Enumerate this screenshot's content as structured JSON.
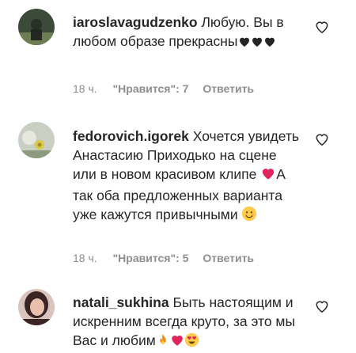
{
  "comments": [
    {
      "username": "iaroslavagudzenko",
      "text": "Любую. Вы в любом образе прекрасны",
      "time": "18 ч.",
      "likes": "\"Нравится\": 7",
      "reply": "Ответить",
      "avatar_icon": "profile-photo-dark"
    },
    {
      "username": "fedorovich.igorek",
      "text": "Хочется увидеть Анастасию Приходько на сцене или в новом красивом клипе",
      "text2": "А так оба предложенных варианта уже кажутся привычными",
      "time": "18 ч.",
      "likes": "\"Нравится\": 5",
      "reply": "Ответить",
      "avatar_icon": "profile-photo-flower"
    },
    {
      "username": "natali_sukhina",
      "text": "Быть настоящим и искренним всегда круто, за это мы Вас и любим",
      "avatar_icon": "profile-photo-woman"
    }
  ],
  "colors": {
    "text": "#262626",
    "meta": "#8e8e8e",
    "heart_red": "#e0245e",
    "black_heart": "#262626"
  }
}
